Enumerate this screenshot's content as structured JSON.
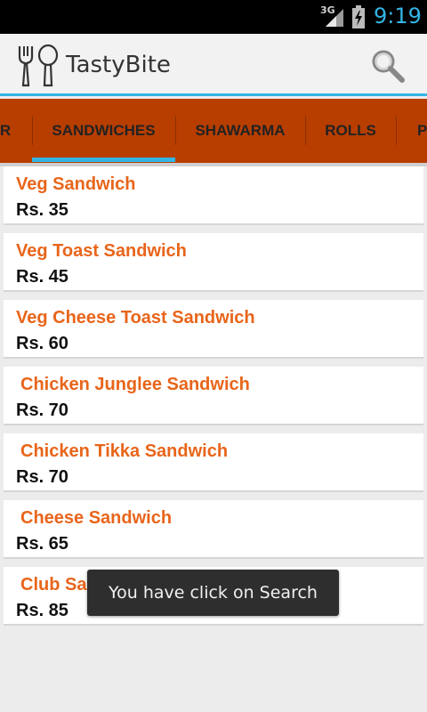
{
  "status_bar": {
    "network_label": "3G",
    "time": "9:19",
    "icons": [
      "signal-icon",
      "battery-charging-icon"
    ]
  },
  "action_bar": {
    "title": "TastyBite",
    "logo_icon": "fork-spoon-logo",
    "search_icon": "search-icon"
  },
  "tabs": [
    {
      "label": "R"
    },
    {
      "label": "SANDWICHES"
    },
    {
      "label": "SHAWARMA"
    },
    {
      "label": "ROLLS"
    },
    {
      "label": "P"
    }
  ],
  "selected_tab": "SANDWICHES",
  "menu_items": [
    {
      "name": "Veg Sandwich",
      "price": "Rs. 35"
    },
    {
      "name": "Veg Toast Sandwich",
      "price": "Rs. 45"
    },
    {
      "name": "Veg Cheese Toast Sandwich",
      "price": "Rs. 60"
    },
    {
      "name": "Chicken Junglee Sandwich",
      "price": "Rs. 70"
    },
    {
      "name": "Chicken Tikka Sandwich",
      "price": "Rs. 70"
    },
    {
      "name": "Cheese Sandwich",
      "price": "Rs. 65"
    },
    {
      "name": "Club Sandwich",
      "price": "Rs. 85"
    }
  ],
  "toast": {
    "message": "You have click on Search"
  },
  "colors": {
    "accent": "#33b5e5",
    "tab_bar": "#b83e00",
    "item_name": "#e8651a"
  }
}
